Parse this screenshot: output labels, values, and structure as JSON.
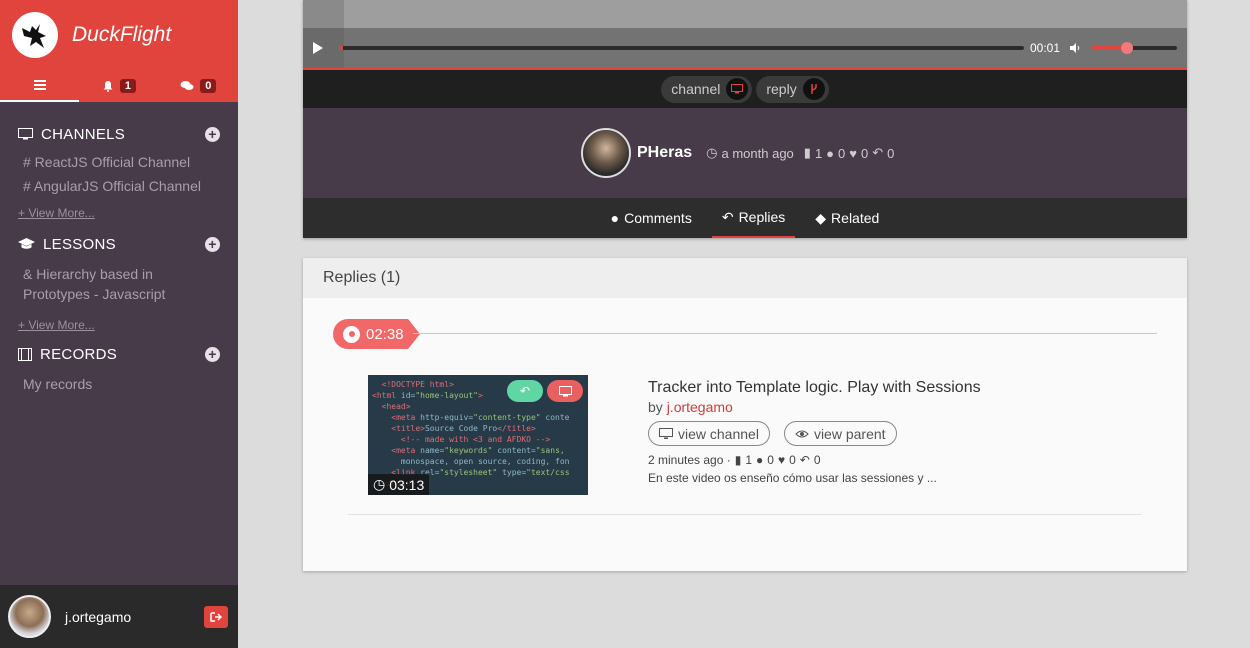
{
  "app": {
    "name": "DuckFlight"
  },
  "sidebar": {
    "tabs": [
      {
        "icon": "menu-icon"
      },
      {
        "icon": "bell-icon",
        "badge": "1"
      },
      {
        "icon": "comments-icon",
        "badge": "0"
      }
    ],
    "channels": {
      "title": "CHANNELS",
      "items": [
        "# ReactJS Official Channel",
        "# AngularJS Official Channel"
      ],
      "view_more": "+ View More..."
    },
    "lessons": {
      "title": "LESSONS",
      "items": [
        "& Hierarchy based in Prototypes - Javascript"
      ],
      "view_more": "+ View More..."
    },
    "records": {
      "title": "RECORDS",
      "items": [
        "My records"
      ]
    },
    "user": {
      "name": "j.ortegamo"
    }
  },
  "player": {
    "time": "00:01",
    "progress": 0.005,
    "volume": 0.4
  },
  "chips": {
    "channel": "channel",
    "reply": "reply"
  },
  "author": {
    "name": "PHeras",
    "posted": "a month ago",
    "files": "1",
    "comments": "0",
    "likes": "0",
    "replies": "0"
  },
  "tabs": {
    "comments": "Comments",
    "replies": "Replies",
    "related": "Related"
  },
  "replies": {
    "header": "Replies (1)",
    "flag_time": "02:38",
    "item": {
      "duration": "03:13",
      "title": "Tracker into Template logic. Play with Sessions",
      "by_prefix": "by ",
      "author": "j.ortegamo",
      "view_channel": "view channel",
      "view_parent": "view parent",
      "posted": "2 minutes ago ·",
      "files": "1",
      "comments": "0",
      "likes": "0",
      "replies": "0",
      "description": "En este video os enseño cómo usar las sessiones y ..."
    }
  },
  "colors": {
    "accent": "#e0443d",
    "sidebar": "#473a49"
  }
}
